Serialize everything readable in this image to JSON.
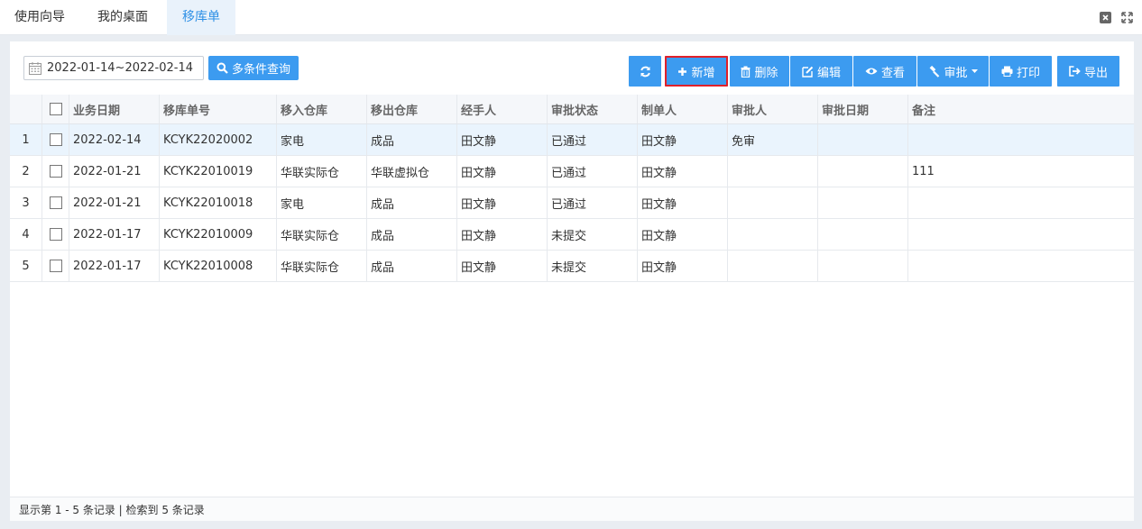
{
  "tabs": [
    {
      "label": "使用向导"
    },
    {
      "label": "我的桌面"
    },
    {
      "label": "移库单"
    }
  ],
  "toolbar": {
    "date_range": "2022-01-14~2022-02-14",
    "query_label": "多条件查询",
    "add_label": "新增",
    "delete_label": "删除",
    "edit_label": "编辑",
    "view_label": "查看",
    "approve_label": "审批",
    "print_label": "打印",
    "export_label": "导出"
  },
  "table": {
    "headers": [
      "业务日期",
      "移库单号",
      "移入仓库",
      "移出仓库",
      "经手人",
      "审批状态",
      "制单人",
      "审批人",
      "审批日期",
      "备注"
    ],
    "rows": [
      {
        "no": "1",
        "date": "2022-02-14",
        "code": "KCYK22020002",
        "in": "家电",
        "out": "成品",
        "handler": "田文静",
        "status": "已通过",
        "maker": "田文静",
        "approver": "免审",
        "approve_date": "",
        "remark": ""
      },
      {
        "no": "2",
        "date": "2022-01-21",
        "code": "KCYK22010019",
        "in": "华联实际仓",
        "out": "华联虚拟仓",
        "handler": "田文静",
        "status": "已通过",
        "maker": "田文静",
        "approver": "",
        "approve_date": "",
        "remark": "111"
      },
      {
        "no": "3",
        "date": "2022-01-21",
        "code": "KCYK22010018",
        "in": "家电",
        "out": "成品",
        "handler": "田文静",
        "status": "已通过",
        "maker": "田文静",
        "approver": "",
        "approve_date": "",
        "remark": ""
      },
      {
        "no": "4",
        "date": "2022-01-17",
        "code": "KCYK22010009",
        "in": "华联实际仓",
        "out": "成品",
        "handler": "田文静",
        "status": "未提交",
        "maker": "田文静",
        "approver": "",
        "approve_date": "",
        "remark": ""
      },
      {
        "no": "5",
        "date": "2022-01-17",
        "code": "KCYK22010008",
        "in": "华联实际仓",
        "out": "成品",
        "handler": "田文静",
        "status": "未提交",
        "maker": "田文静",
        "approver": "",
        "approve_date": "",
        "remark": ""
      }
    ]
  },
  "footer": {
    "text": "显示第 1 - 5 条记录 | 检索到 5 条记录"
  },
  "colors": {
    "primary": "#3c9bf0",
    "highlight": "#e0202a",
    "tab_active": "#2e90e6"
  }
}
